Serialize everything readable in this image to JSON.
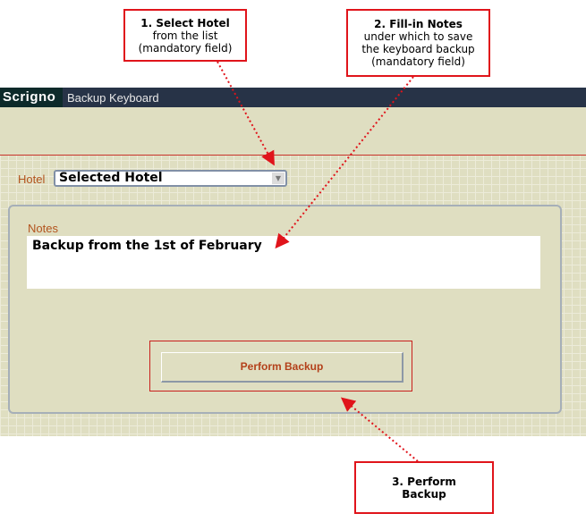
{
  "callouts": [
    {
      "title": "1. Select Hotel",
      "lines": [
        "from the list",
        "(mandatory field)"
      ]
    },
    {
      "title": "2. Fill-in Notes",
      "lines": [
        "under which to save",
        "the keyboard backup",
        "(mandatory field)"
      ]
    },
    {
      "title": "3. Perform",
      "lines": [
        "Backup"
      ]
    }
  ],
  "app": {
    "logo": "Scrigno",
    "title": "Backup Keyboard"
  },
  "form": {
    "hotel_label": "Hotel",
    "hotel_value": "Selected Hotel",
    "notes_label": "Notes",
    "notes_value": "Backup from the 1st of February",
    "button_label": "Perform Backup"
  },
  "colors": {
    "callout_border": "#e0141b",
    "titlebar": "#273347",
    "label": "#b3541e"
  }
}
